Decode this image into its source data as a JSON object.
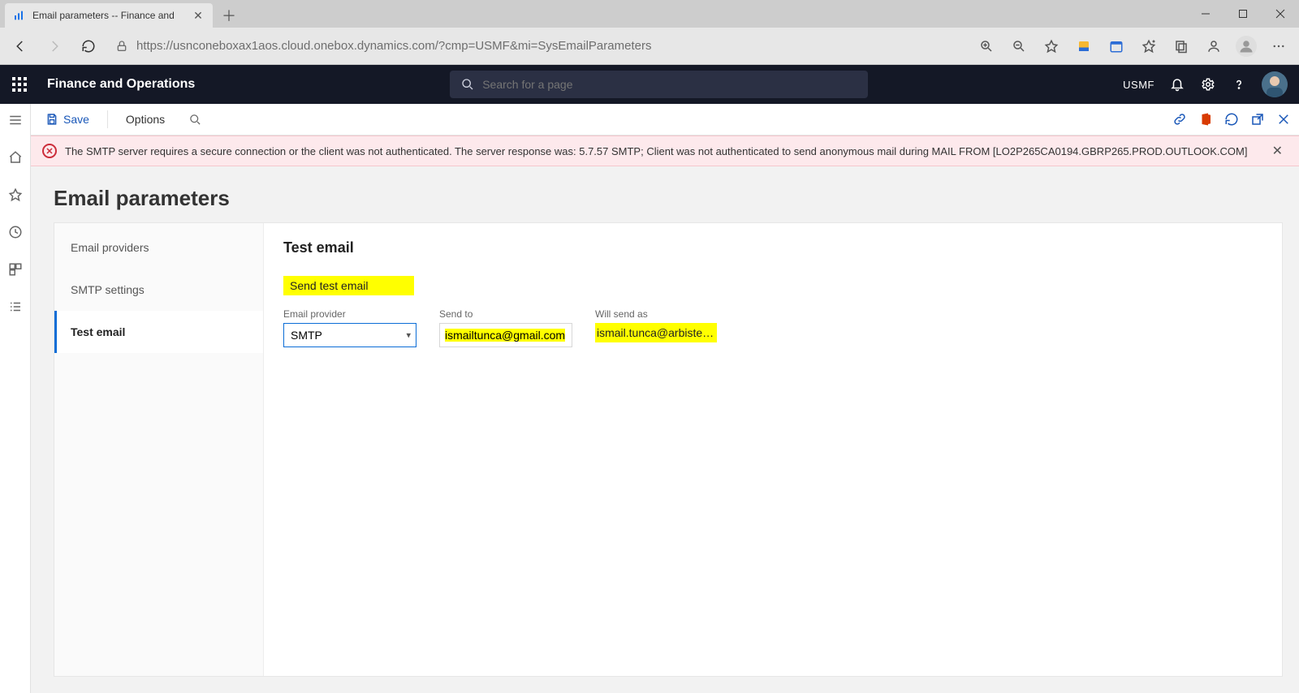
{
  "browser": {
    "tab_title": "Email parameters -- Finance and",
    "url": "https://usnconeboxax1aos.cloud.onebox.dynamics.com/?cmp=USMF&mi=SysEmailParameters"
  },
  "nav": {
    "app_title": "Finance and Operations",
    "search_placeholder": "Search for a page",
    "legal_entity": "USMF"
  },
  "actionbar": {
    "save": "Save",
    "options": "Options"
  },
  "error": {
    "message": "The SMTP server requires a secure connection or the client was not authenticated. The server response was: 5.7.57 SMTP; Client was not authenticated to send anonymous mail during MAIL FROM [LO2P265CA0194.GBRP265.PROD.OUTLOOK.COM]"
  },
  "page": {
    "heading": "Email parameters",
    "tabs": [
      "Email providers",
      "SMTP settings",
      "Test email"
    ],
    "active_tab_index": 2
  },
  "test_email": {
    "section_title": "Test email",
    "send_button": "Send test email",
    "fields": {
      "provider_label": "Email provider",
      "provider_value": "SMTP",
      "send_to_label": "Send to",
      "send_to_value": "ismailtunca@gmail.com",
      "will_send_as_label": "Will send as",
      "will_send_as_value": "ismail.tunca@arbistec…"
    }
  }
}
